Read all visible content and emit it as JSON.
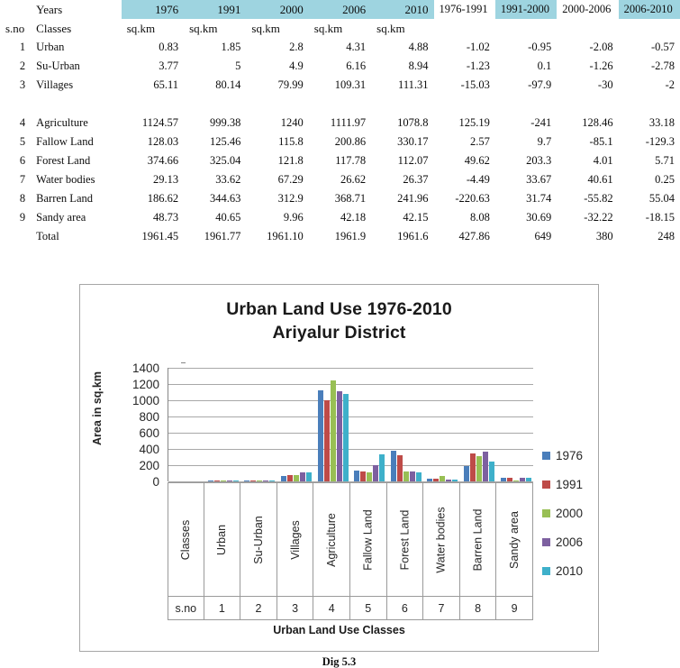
{
  "table": {
    "header_row1": {
      "sno": "",
      "label": "Years",
      "years": [
        "1976",
        "1991",
        "2000",
        "2006",
        "2010"
      ],
      "diffs": [
        "1976-1991",
        "1991-2000",
        "2000-2006",
        "2006-2010"
      ]
    },
    "header_row2": {
      "sno": "s.no",
      "label": "Classes",
      "units": [
        "sq.km",
        "sq.km",
        "sq.km",
        "sq.km",
        "sq.km"
      ]
    },
    "rows": [
      {
        "sno": "1",
        "cls": "Urban",
        "vals": [
          "0.83",
          "1.85",
          "2.8",
          "4.31",
          "4.88"
        ],
        "diffs": [
          "-1.02",
          "-0.95",
          "-2.08",
          "-0.57"
        ]
      },
      {
        "sno": "2",
        "cls": "Su-Urban",
        "vals": [
          "3.77",
          "5",
          "4.9",
          "6.16",
          "8.94"
        ],
        "diffs": [
          "-1.23",
          "0.1",
          "-1.26",
          "-2.78"
        ]
      },
      {
        "sno": "3",
        "cls": "Villages",
        "vals": [
          "65.11",
          "80.14",
          "79.99",
          "109.31",
          "111.31"
        ],
        "diffs": [
          "-15.03",
          "-97.9",
          "-30",
          "-2"
        ]
      },
      {
        "sno": "4",
        "cls": "Agriculture",
        "vals": [
          "1124.57",
          "999.38",
          "1240",
          "1111.97",
          "1078.8"
        ],
        "diffs": [
          "125.19",
          "-241",
          "128.46",
          "33.18"
        ]
      },
      {
        "sno": "5",
        "cls": "Fallow Land",
        "vals": [
          "128.03",
          "125.46",
          "115.8",
          "200.86",
          "330.17"
        ],
        "diffs": [
          "2.57",
          "9.7",
          "-85.1",
          "-129.3"
        ]
      },
      {
        "sno": "6",
        "cls": "Forest Land",
        "vals": [
          "374.66",
          "325.04",
          "121.8",
          "117.78",
          "112.07"
        ],
        "diffs": [
          "49.62",
          "203.3",
          "4.01",
          "5.71"
        ]
      },
      {
        "sno": "7",
        "cls": "Water bodies",
        "vals": [
          "29.13",
          "33.62",
          "67.29",
          "26.62",
          "26.37"
        ],
        "diffs": [
          "-4.49",
          "33.67",
          "40.61",
          "0.25"
        ]
      },
      {
        "sno": "8",
        "cls": "Barren Land",
        "vals": [
          "186.62",
          "344.63",
          "312.9",
          "368.71",
          "241.96"
        ],
        "diffs": [
          "-220.63",
          "31.74",
          "-55.82",
          "55.04"
        ]
      },
      {
        "sno": "9",
        "cls": "Sandy area",
        "vals": [
          "48.73",
          "40.65",
          "9.96",
          "42.18",
          "42.15"
        ],
        "diffs": [
          "8.08",
          "30.69",
          "-32.22",
          "-18.15"
        ]
      }
    ],
    "total": {
      "sno": "",
      "cls": "Total",
      "vals": [
        "1961.45",
        "1961.77",
        "1961.10",
        "1961.9",
        "1961.6"
      ],
      "diffs": [
        "427.86",
        "649",
        "380",
        "248"
      ]
    }
  },
  "chart_data": {
    "type": "bar",
    "title": "Urban Land Use 1976-2010\nAriyalur District",
    "title_line1": "Urban Land Use 1976-2010",
    "title_line2": "Ariyalur District",
    "xlabel": "Urban Land Use Classes",
    "ylabel": "Area in sq.km",
    "ylim": [
      0,
      1400
    ],
    "yticks": [
      "1400",
      "1200",
      "1000",
      "800",
      "600",
      "400",
      "200",
      "0"
    ],
    "grid": true,
    "legend_position": "right",
    "categories": [
      "Urban",
      "Su-Urban",
      "Villages",
      "Agriculture",
      "Fallow Land",
      "Forest Land",
      "Water bodies",
      "Barren Land",
      "Sandy area"
    ],
    "datatable_header": "Classes",
    "datatable_sno_label": "s.no",
    "datatable_snos": [
      "1",
      "2",
      "3",
      "4",
      "5",
      "6",
      "7",
      "8",
      "9"
    ],
    "series": [
      {
        "name": "1976",
        "color": "#4a7ebb",
        "values": [
          0.83,
          3.77,
          65.11,
          1124.57,
          128.03,
          374.66,
          29.13,
          186.62,
          48.73
        ]
      },
      {
        "name": "1991",
        "color": "#be4b48",
        "values": [
          1.85,
          5,
          80.14,
          999.38,
          125.46,
          325.04,
          33.62,
          344.63,
          40.65
        ]
      },
      {
        "name": "2000",
        "color": "#98bf54",
        "values": [
          2.8,
          4.9,
          79.99,
          1240,
          115.8,
          121.8,
          67.29,
          312.9,
          9.96
        ]
      },
      {
        "name": "2006",
        "color": "#7d60a0",
        "values": [
          4.31,
          6.16,
          109.31,
          1111.97,
          200.86,
          117.78,
          26.62,
          368.71,
          42.18
        ]
      },
      {
        "name": "2010",
        "color": "#3eb0ca",
        "values": [
          4.88,
          8.94,
          111.31,
          1078.8,
          330.17,
          112.07,
          26.37,
          241.96,
          42.15
        ]
      }
    ]
  },
  "caption": "Dig 5.3",
  "colors": {
    "header_shade": "#9ed4e0",
    "chart_border": "#a6a6a6",
    "gridline": "#a8a8a8"
  }
}
